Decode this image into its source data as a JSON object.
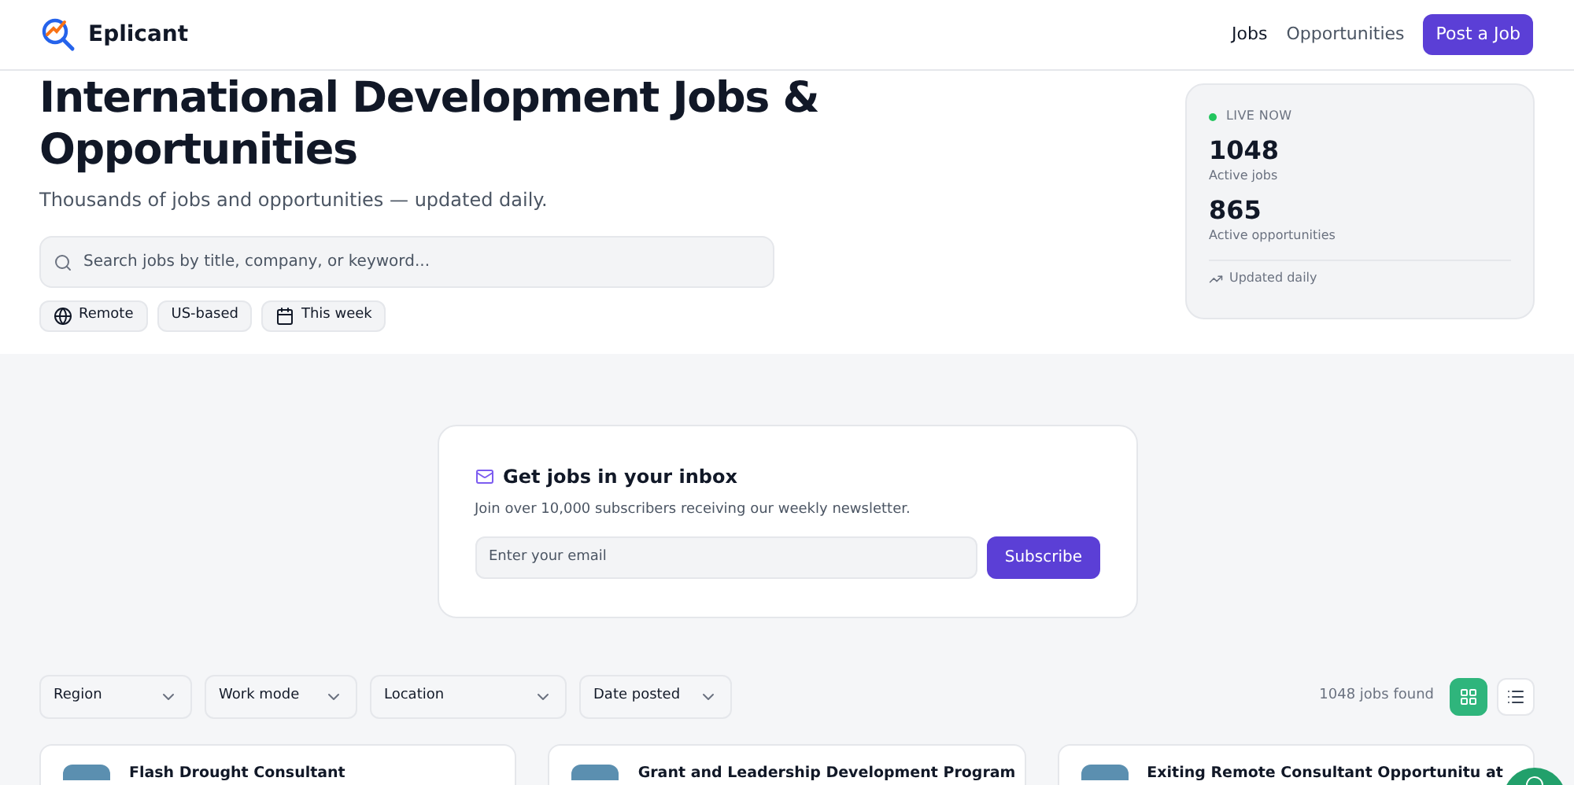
{
  "header": {
    "logo": "Eplicant",
    "nav": [
      {
        "label": "Jobs",
        "selected": true
      },
      {
        "label": "Opportunities",
        "selected": false
      }
    ],
    "cta": "Post a Job"
  },
  "hero": {
    "title": "International Development Jobs & Opportunities",
    "subtitle": "Thousands of jobs and opportunities — updated daily.",
    "search": {
      "placeholder": "Search jobs by title, company, or keyword..."
    },
    "chips": [
      {
        "label": "Remote",
        "kind": "globe"
      },
      {
        "label": "US-based",
        "kind": "plain"
      },
      {
        "label": "This week",
        "kind": "calendar"
      }
    ]
  },
  "stats": {
    "live": "LIVE NOW",
    "items": [
      {
        "value": "1048",
        "label": "Active jobs"
      },
      {
        "value": "865",
        "label": "Active opportunities"
      }
    ],
    "footer": "Updated daily"
  },
  "newsletter": {
    "title": "Get jobs in your inbox",
    "text": "Join over 10,000 subscribers receiving our weekly newsletter.",
    "email": {
      "placeholder": "Enter your email"
    },
    "button": "Subscribe"
  },
  "filters": [
    "Region",
    "Work mode",
    "Location",
    "Date posted"
  ],
  "count": "1048 jobs found",
  "views": [
    {
      "kind": "grid",
      "selected": true
    },
    {
      "kind": "list",
      "selected": false
    }
  ],
  "jobs": [
    {
      "title": "Flash Drought Consultant"
    },
    {
      "title": "Grant and Leadership Development Program"
    },
    {
      "title": "Exiting Remote Consultant Opportunitu at"
    }
  ]
}
